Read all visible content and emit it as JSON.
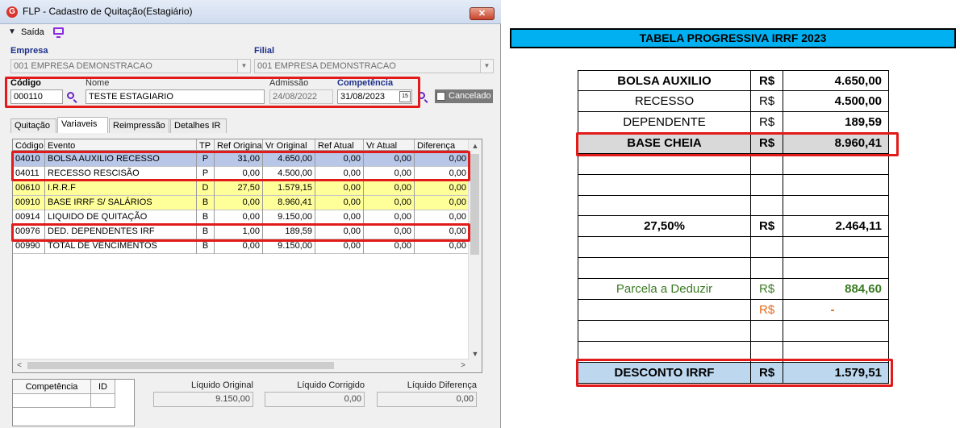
{
  "window": {
    "title": "FLP - Cadastro de Quitação(Estagiário)",
    "close_glyph": "✕",
    "toolbar": {
      "exit_label": "Saída"
    }
  },
  "form": {
    "empresa_label": "Empresa",
    "empresa_value": "001 EMPRESA DEMONSTRACAO",
    "filial_label": "Filial",
    "filial_value": "001 EMPRESA DEMONSTRACAO",
    "codigo_label": "Código",
    "codigo_value": "000110",
    "nome_label": "Nome",
    "nome_value": "TESTE ESTAGIARIO",
    "admissao_label": "Admissão",
    "admissao_value": "24/08/2022",
    "competencia_label": "Competência",
    "competencia_value": "31/08/2023",
    "cancelado_label": "Cancelado",
    "cancelado_checked": false
  },
  "tabs": [
    {
      "label": "Quitação"
    },
    {
      "label": "Variaveis",
      "active": true
    },
    {
      "label": "Reimpressão"
    },
    {
      "label": "Detalhes IR"
    }
  ],
  "grid": {
    "headers": [
      "Código",
      "Evento",
      "TP",
      "Ref Original",
      "Vr Original",
      "Ref Atual",
      "Vr Atual",
      "Diferença"
    ],
    "rows": [
      {
        "codigo": "04010",
        "evento": "BOLSA AUXILIO RECESSO",
        "tp": "P",
        "ref_original": "31,00",
        "vr_original": "4.650,00",
        "ref_atual": "0,00",
        "vr_atual": "0,00",
        "diferenca": "0,00",
        "style": "selected"
      },
      {
        "codigo": "04011",
        "evento": "RECESSO RESCISÃO",
        "tp": "P",
        "ref_original": "0,00",
        "vr_original": "4.500,00",
        "ref_atual": "0,00",
        "vr_atual": "0,00",
        "diferenca": "0,00",
        "style": "normal"
      },
      {
        "codigo": "00610",
        "evento": "I.R.R.F",
        "tp": "D",
        "ref_original": "27,50",
        "vr_original": "1.579,15",
        "ref_atual": "0,00",
        "vr_atual": "0,00",
        "diferenca": "0,00",
        "style": "yellow"
      },
      {
        "codigo": "00910",
        "evento": "BASE IRRF S/ SALÁRIOS",
        "tp": "B",
        "ref_original": "0,00",
        "vr_original": "8.960,41",
        "ref_atual": "0,00",
        "vr_atual": "0,00",
        "diferenca": "0,00",
        "style": "yellow"
      },
      {
        "codigo": "00914",
        "evento": "LIQUIDO DE QUITAÇÃO",
        "tp": "B",
        "ref_original": "0,00",
        "vr_original": "9.150,00",
        "ref_atual": "0,00",
        "vr_atual": "0,00",
        "diferenca": "0,00",
        "style": "normal"
      },
      {
        "codigo": "00976",
        "evento": "DED. DEPENDENTES IRF",
        "tp": "B",
        "ref_original": "1,00",
        "vr_original": "189,59",
        "ref_atual": "0,00",
        "vr_atual": "0,00",
        "diferenca": "0,00",
        "style": "normal"
      },
      {
        "codigo": "00990",
        "evento": "TOTAL DE VENCIMENTOS",
        "tp": "B",
        "ref_original": "0,00",
        "vr_original": "9.150,00",
        "ref_atual": "0,00",
        "vr_atual": "0,00",
        "diferenca": "0,00",
        "style": "normal"
      }
    ]
  },
  "bottom": {
    "competencia_header": "Competência",
    "id_header": "ID",
    "liquido_original_label": "Líquido Original",
    "liquido_original_value": "9.150,00",
    "liquido_corrigido_label": "Líquido Corrigido",
    "liquido_corrigido_value": "0,00",
    "liquido_diferenca_label": "Líquido Diferença",
    "liquido_diferenca_value": "0,00"
  },
  "sheet": {
    "title": "TABELA PROGRESSIVA IRRF 2023",
    "rows": [
      {
        "label": "BOLSA AUXILIO",
        "currency": "R$",
        "value": "4.650,00"
      },
      {
        "label": "RECESSO",
        "currency": "R$",
        "value": "4.500,00"
      },
      {
        "label": "DEPENDENTE",
        "currency": "R$",
        "value": "189,59"
      },
      {
        "label": "BASE CHEIA",
        "currency": "R$",
        "value": "8.960,41"
      },
      {
        "label": "",
        "currency": "",
        "value": ""
      },
      {
        "label": "",
        "currency": "",
        "value": ""
      },
      {
        "label": "",
        "currency": "",
        "value": ""
      },
      {
        "label": "27,50%",
        "currency": "R$",
        "value": "2.464,11"
      },
      {
        "label": "",
        "currency": "",
        "value": ""
      },
      {
        "label": "",
        "currency": "",
        "value": ""
      },
      {
        "label": "Parcela a Deduzir",
        "currency": "R$",
        "value": "884,60"
      },
      {
        "label": "",
        "currency": "R$",
        "value": "-"
      },
      {
        "label": "",
        "currency": "",
        "value": ""
      },
      {
        "label": "",
        "currency": "",
        "value": ""
      },
      {
        "label": "DESCONTO IRRF",
        "currency": "R$",
        "value": "1.579,51"
      }
    ]
  },
  "colors": {
    "title_bar_cyan": "#00b0f0",
    "highlight_red": "#e21a1a",
    "base_cheia_fill": "#d9d9d9",
    "desconto_fill": "#bdd7ee",
    "green_text": "#3a7a22",
    "orange_text": "#e06a16",
    "grid_selected": "#b8c7e8",
    "grid_yellow": "#ffff99"
  }
}
